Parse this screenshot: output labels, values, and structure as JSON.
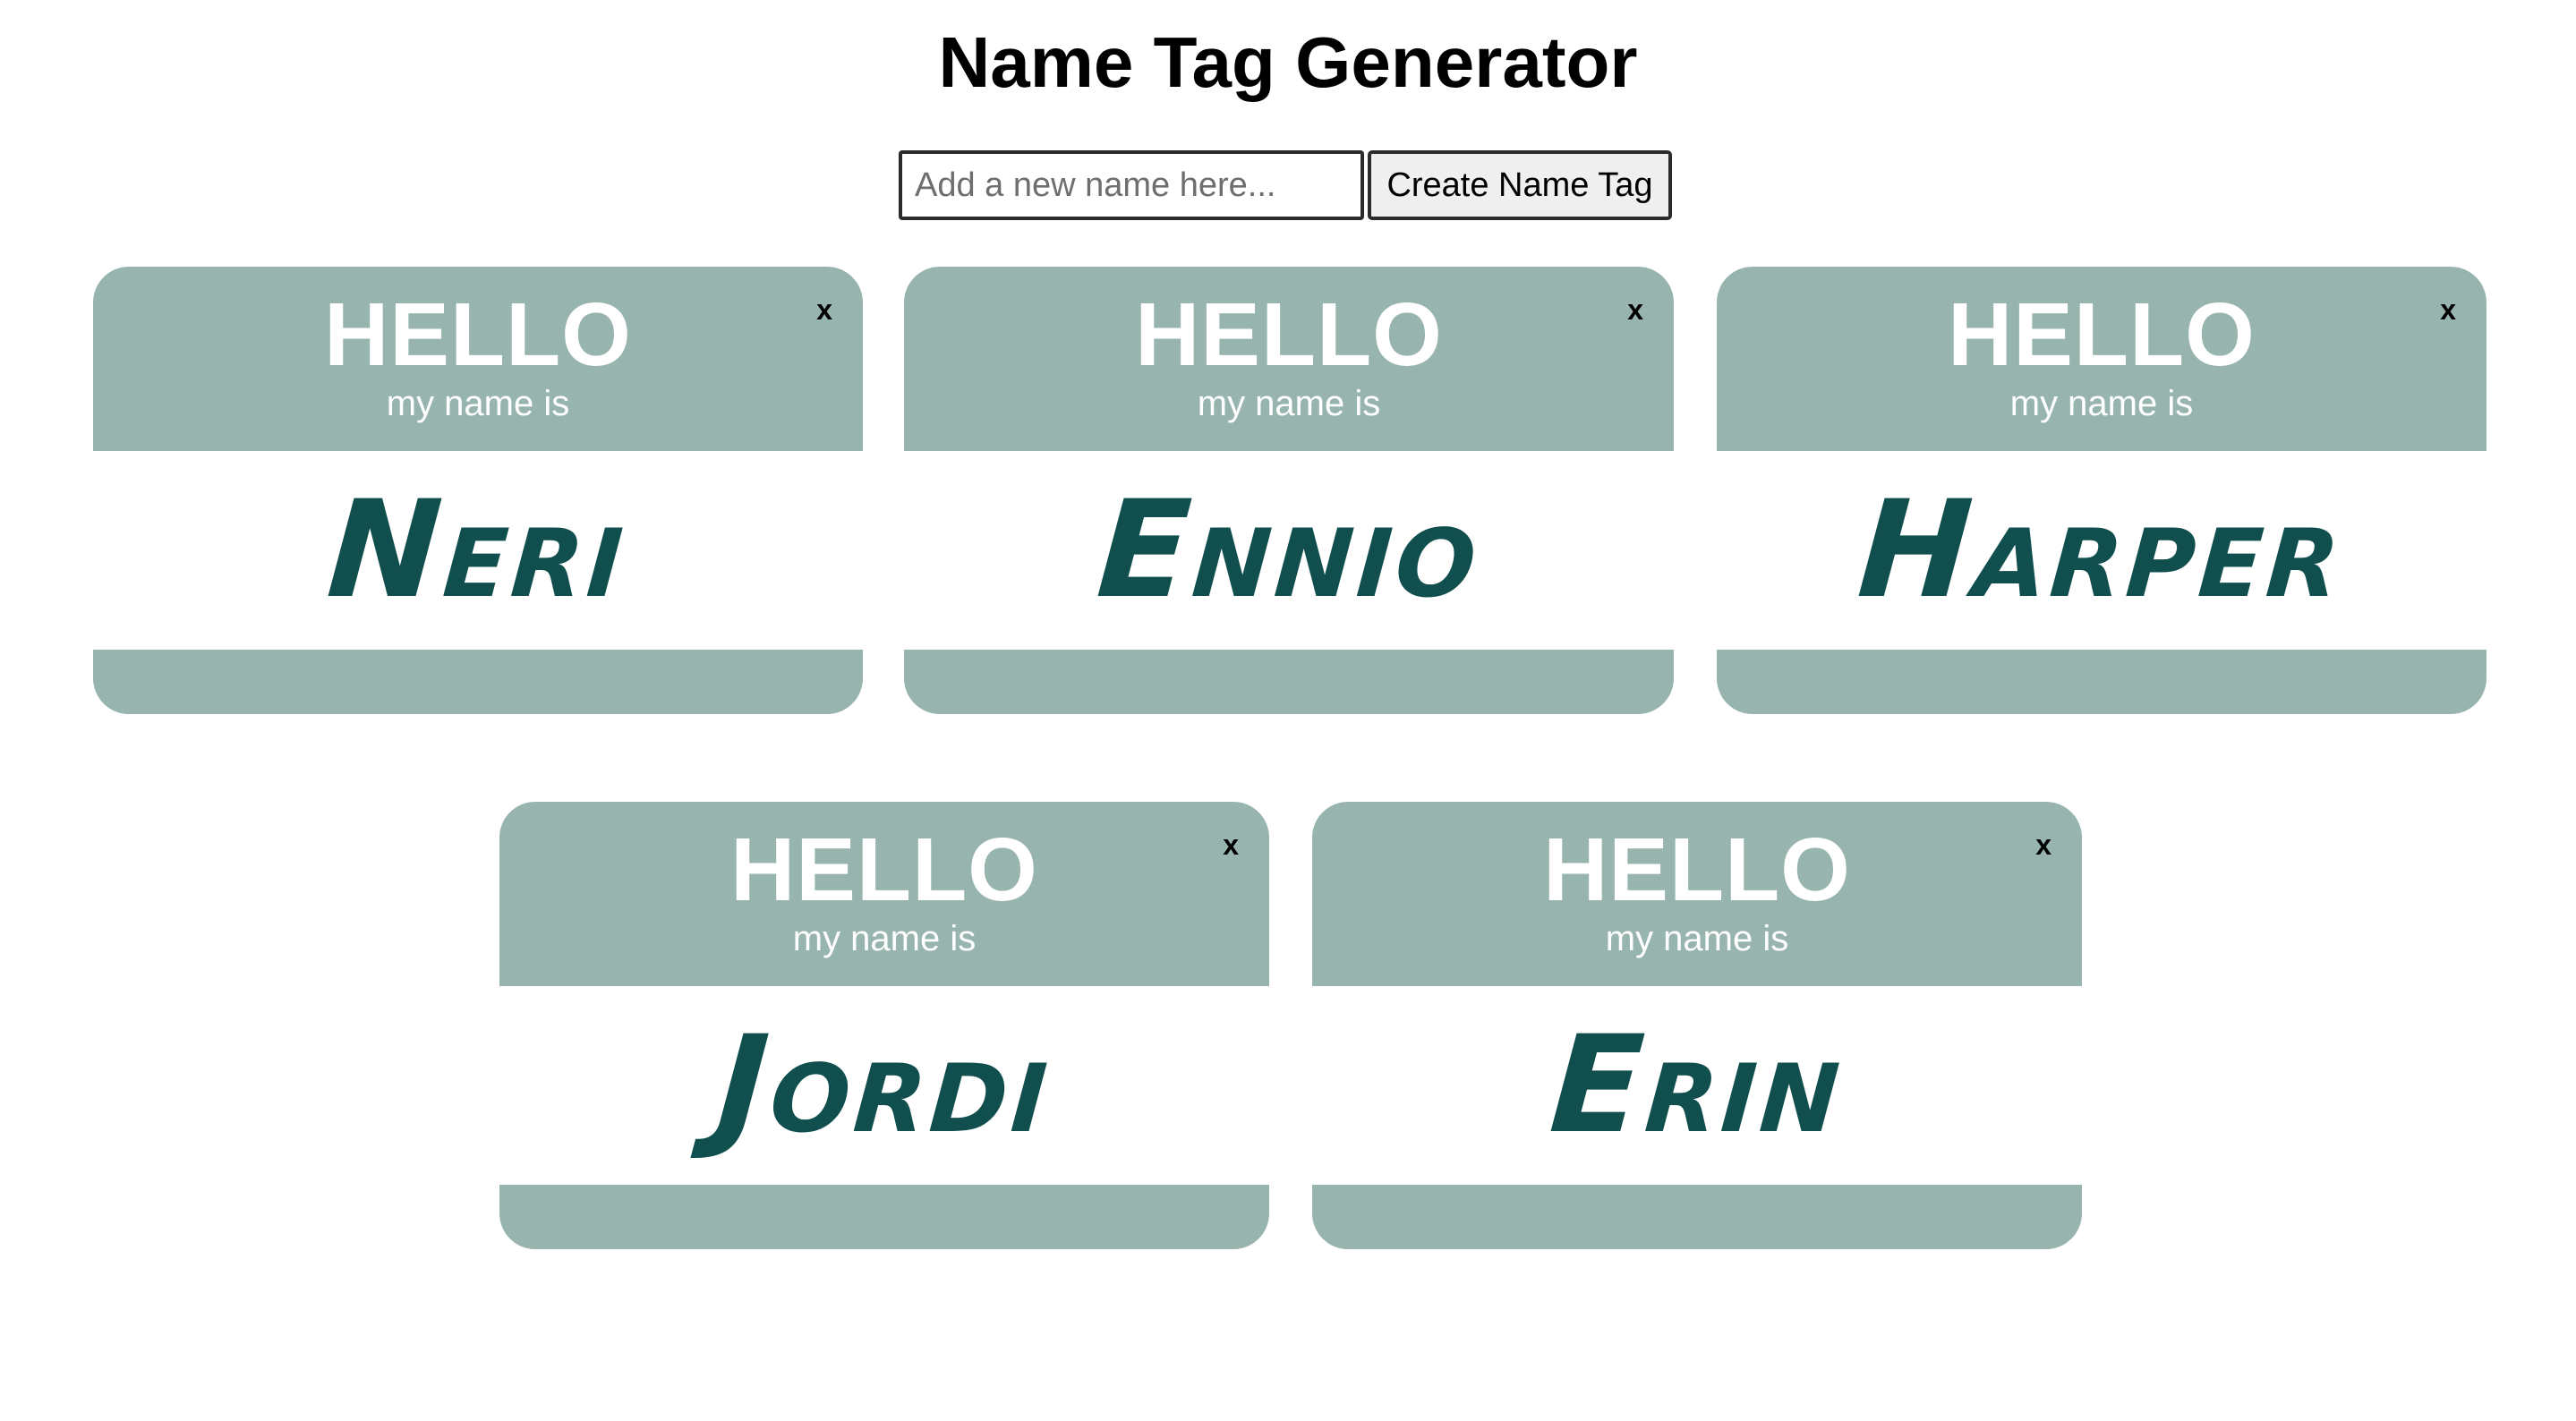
{
  "header": {
    "title": "Name Tag Generator"
  },
  "form": {
    "input_value": "",
    "input_placeholder": "Add a new name here...",
    "create_label": "Create Name Tag"
  },
  "tags": [
    {
      "greeting": "HELLO",
      "subtitle": "my name is",
      "name": "Neri",
      "close": "x"
    },
    {
      "greeting": "HELLO",
      "subtitle": "my name is",
      "name": "Ennio",
      "close": "x"
    },
    {
      "greeting": "HELLO",
      "subtitle": "my name is",
      "name": "Harper",
      "close": "x"
    },
    {
      "greeting": "HELLO",
      "subtitle": "my name is",
      "name": "Jordi",
      "close": "x"
    },
    {
      "greeting": "HELLO",
      "subtitle": "my name is",
      "name": "Erin",
      "close": "x"
    }
  ],
  "colors": {
    "tag_band": "#98b4ae",
    "name_text": "#104f4e",
    "page_background": "#ffffff"
  },
  "icons": {
    "close": "close-icon"
  }
}
